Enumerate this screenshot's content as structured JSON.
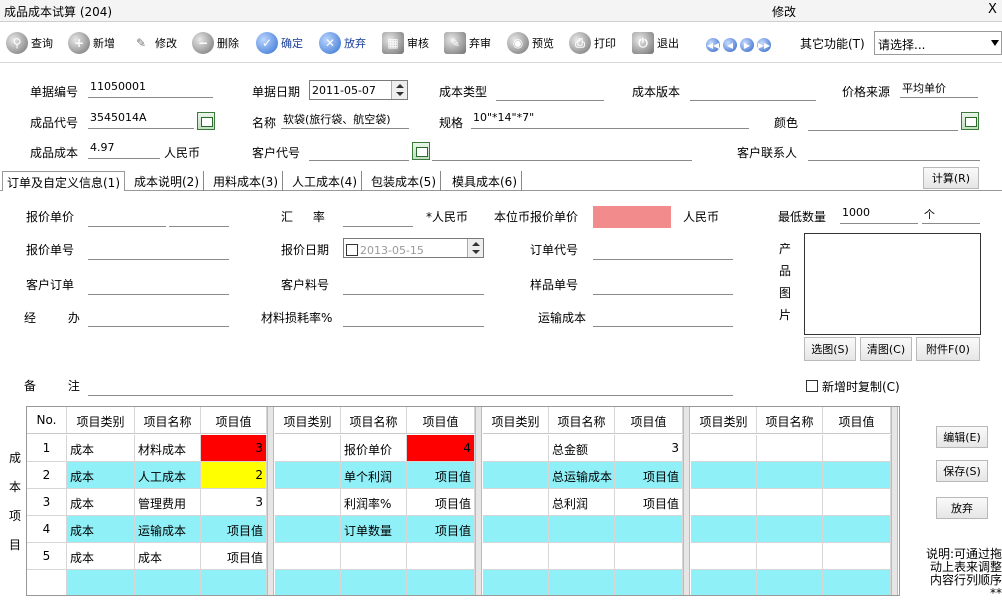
{
  "window": {
    "title": "成品成本试算 (204)",
    "mode": "修改",
    "close": "X"
  },
  "toolbar": {
    "query": "查询",
    "add": "新增",
    "edit": "修改",
    "delete": "删除",
    "confirm": "确定",
    "discard": "放弃",
    "audit": "审核",
    "unaudit": "弃审",
    "preview": "预览",
    "print": "打印",
    "exit": "退出",
    "other_label": "其它功能(T)",
    "select_placeholder": "请选择..."
  },
  "header": {
    "doc_no_label": "单据编号",
    "doc_no": "11050001",
    "doc_date_label": "单据日期",
    "doc_date": "2011-05-07",
    "cost_type_label": "成本类型",
    "cost_type": "",
    "cost_version_label": "成本版本",
    "cost_version": "",
    "price_source_label": "价格来源",
    "price_source": "平均单价",
    "product_code_label": "成品代号",
    "product_code": "3545014A",
    "name_label": "名称",
    "name": "软袋(旅行袋、航空袋)",
    "spec_label": "规格",
    "spec": "10\"*14\"*7\"",
    "color_label": "颜色",
    "color": "",
    "product_cost_label": "成品成本",
    "product_cost": "4.97",
    "currency": "人民币",
    "customer_code_label": "客户代号",
    "customer_code": "",
    "customer_contact_label": "客户联系人",
    "customer_contact": ""
  },
  "tabs": [
    "订单及自定义信息(1)",
    "成本说明(2)",
    "用料成本(3)",
    "人工成本(4)",
    "包装成本(5)",
    "模具成本(6)"
  ],
  "calc_button": "计算(R)",
  "form": {
    "quote_price_label": "报价单价",
    "rate_label": "汇 率",
    "rate_currency": "*人民币",
    "local_price_label": "本位币报价单价",
    "local_currency": "人民币",
    "min_qty_label": "最低数量",
    "min_qty": "1000",
    "min_unit": "个",
    "quote_no_label": "报价单号",
    "quote_date_label": "报价日期",
    "quote_date": "2013-05-15",
    "order_code_label": "订单代号",
    "cust_order_label": "客户订单",
    "cust_part_label": "客户料号",
    "sample_no_label": "样品单号",
    "handler_label": "经 办",
    "loss_rate_label": "材料损耗率%",
    "shipping_cost_label": "运输成本",
    "remark_label": "备 注",
    "image_label": "产品图片",
    "select_image": "选图(S)",
    "clear_image": "清图(C)",
    "attachment": "附件F(0)",
    "copy_on_new": "新增时复制(C)"
  },
  "grid": {
    "side_label": [
      "成",
      "本",
      "项",
      "目"
    ],
    "headers": [
      "No.",
      "项目类别",
      "项目名称",
      "项目值",
      "项目类别",
      "项目名称",
      "项目值",
      "项目类别",
      "项目名称",
      "项目值",
      "项目类别",
      "项目名称",
      "项目值"
    ],
    "rows": [
      {
        "no": "1",
        "c1": "成本",
        "n1": "材料成本",
        "v1": "3",
        "c2": "",
        "n2": "报价单价",
        "v2": "4",
        "c3": "",
        "n3": "总金额",
        "v3": "3"
      },
      {
        "no": "2",
        "c1": "成本",
        "n1": "人工成本",
        "v1": "2",
        "c2": "",
        "n2": "单个利润",
        "v2": "项目值",
        "c3": "",
        "n3": "总运输成本",
        "v3": "项目值"
      },
      {
        "no": "3",
        "c1": "成本",
        "n1": "管理费用",
        "v1": "3",
        "c2": "",
        "n2": "利润率%",
        "v2": "项目值",
        "c3": "",
        "n3": "总利润",
        "v3": "项目值"
      },
      {
        "no": "4",
        "c1": "成本",
        "n1": "运输成本",
        "v1": "项目值",
        "c2": "",
        "n2": "订单数量",
        "v2": "项目值",
        "c3": "",
        "n3": "",
        "v3": ""
      },
      {
        "no": "5",
        "c1": "成本",
        "n1": "成本",
        "v1": "项目值",
        "c2": "",
        "n2": "",
        "v2": "",
        "c3": "",
        "n3": "",
        "v3": ""
      }
    ]
  },
  "right_buttons": {
    "edit": "编辑(E)",
    "save": "保存(S)",
    "discard": "放弃"
  },
  "note": "说明:可通过拖动上表来调整内容行列顺序**",
  "colors": {
    "cyan": "#8ff0f7",
    "red": "#ff0000",
    "yellow": "#ffff00",
    "pink": "#f28b8b",
    "link_blue": "#1a3f9a"
  }
}
